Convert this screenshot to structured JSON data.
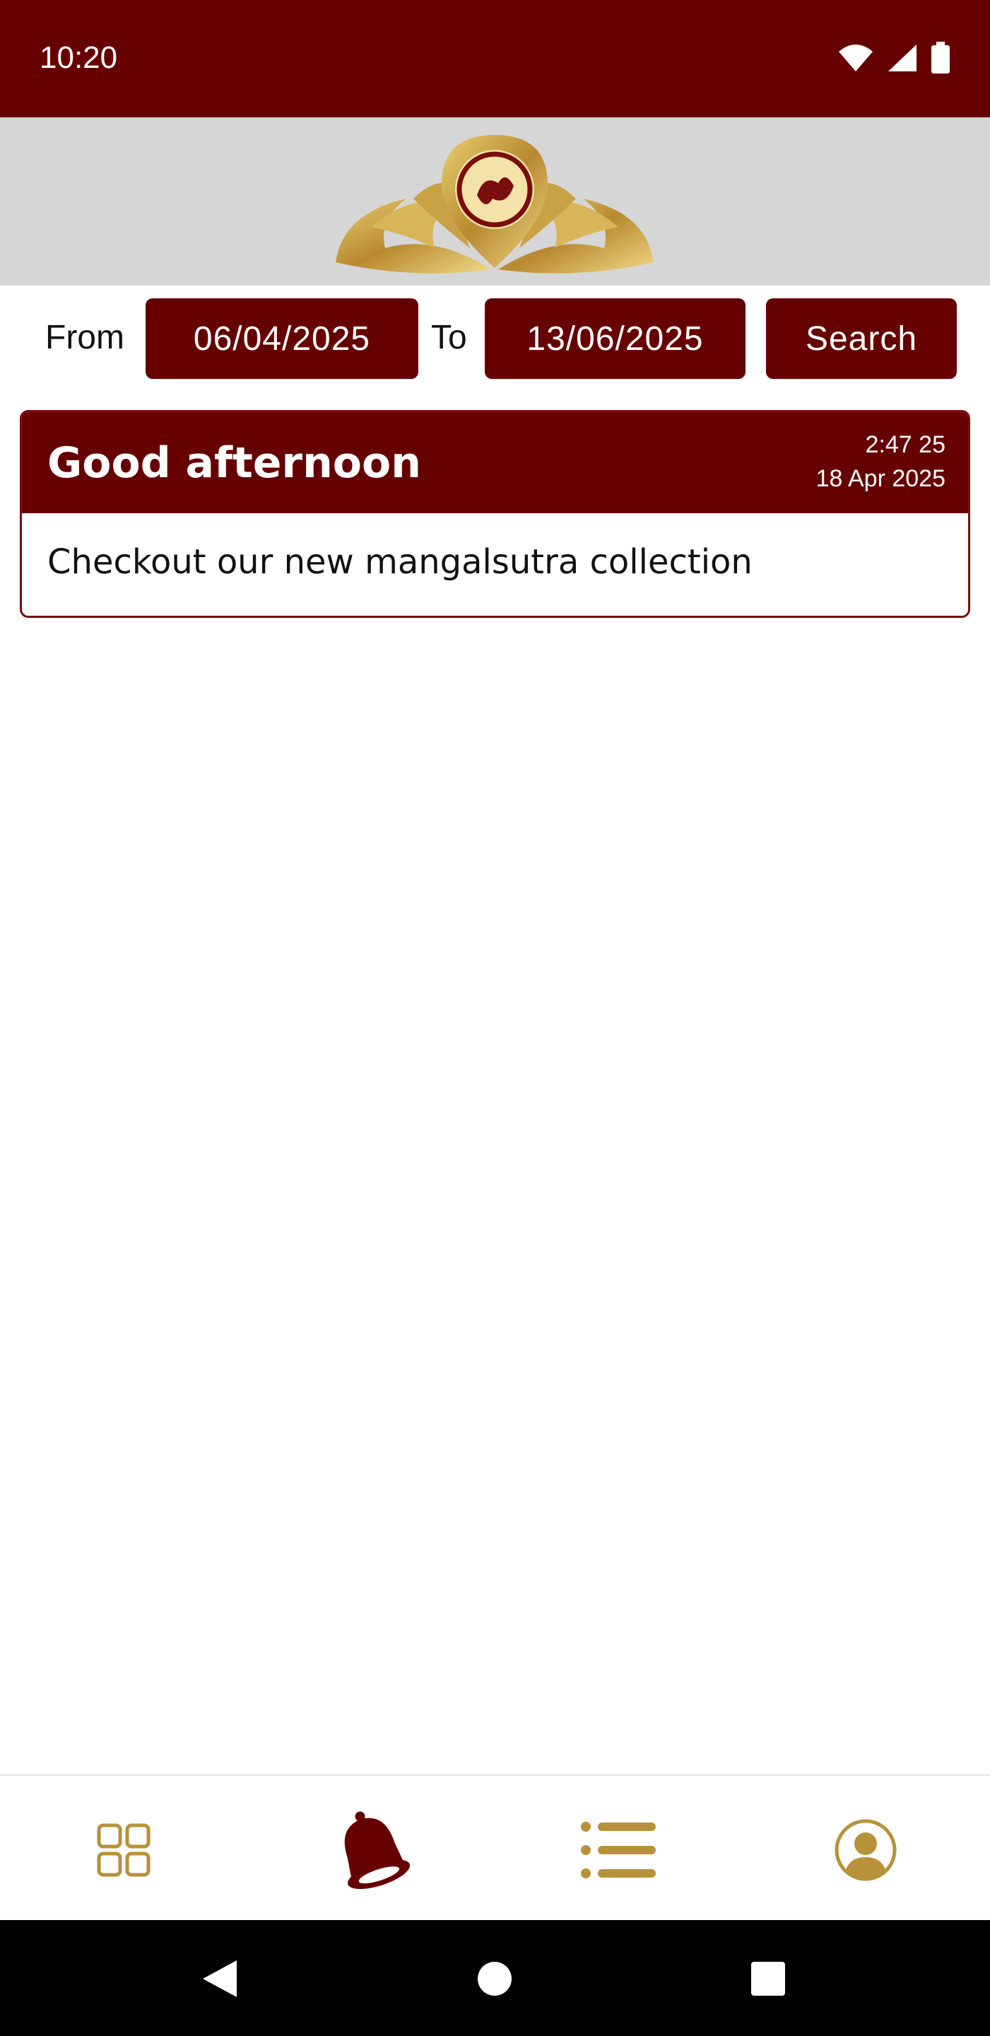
{
  "status_bar": {
    "time": "10:20",
    "icons": [
      "wifi-icon",
      "signal-icon",
      "battery-icon"
    ]
  },
  "header": {
    "logo_icon": "shree-lotus-logo"
  },
  "filter": {
    "from_label": "From",
    "from_date": "06/04/2025",
    "to_label": "To",
    "to_date": "13/06/2025",
    "search_label": "Search"
  },
  "notifications": [
    {
      "title": "Good afternoon",
      "time": "2:47 25",
      "date": "18 Apr 2025",
      "message": "Checkout our new mangalsutra collection"
    }
  ],
  "bottom_nav": {
    "items": [
      {
        "icon": "grid-icon",
        "active": false
      },
      {
        "icon": "bell-icon",
        "active": true
      },
      {
        "icon": "list-icon",
        "active": false
      },
      {
        "icon": "profile-icon",
        "active": false
      }
    ]
  },
  "colors": {
    "primary": "#660000",
    "gold": "#b8923a",
    "header_bg": "#d6d6d6"
  }
}
